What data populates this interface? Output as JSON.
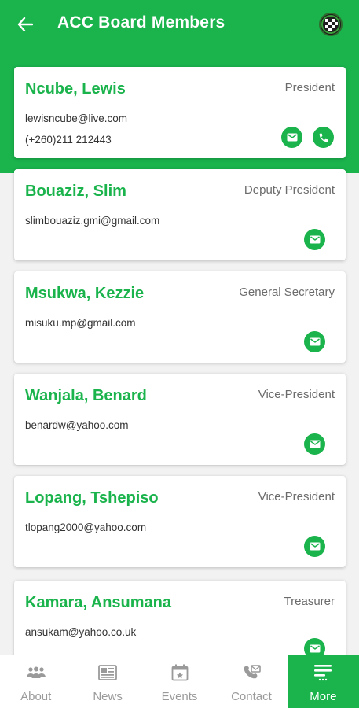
{
  "colors": {
    "brand": "#1ab34c",
    "nav_inactive": "#9a9a9a"
  },
  "header": {
    "title": "ACC Board Members",
    "back_icon": "arrow-left-icon",
    "logo_icon": "chess-club-logo"
  },
  "members": [
    {
      "name": "Ncube, Lewis",
      "role": "President",
      "email": "lewisncube@live.com",
      "phone": "(+260)211 212443"
    },
    {
      "name": "Bouaziz, Slim",
      "role": "Deputy President",
      "email": "slimbouaziz.gmi@gmail.com"
    },
    {
      "name": "Msukwa, Kezzie",
      "role": "General Secretary",
      "email": "misuku.mp@gmail.com"
    },
    {
      "name": "Wanjala, Benard",
      "role": "Vice-President",
      "email": "benardw@yahoo.com"
    },
    {
      "name": "Lopang, Tshepiso",
      "role": "Vice-President",
      "email": "tlopang2000@yahoo.com"
    },
    {
      "name": "Kamara, Ansumana",
      "role": "Treasurer",
      "email": "ansukam@yahoo.co.uk"
    }
  ],
  "nav": {
    "items": [
      {
        "label": "About",
        "icon": "people-icon"
      },
      {
        "label": "News",
        "icon": "newspaper-icon"
      },
      {
        "label": "Events",
        "icon": "calendar-icon"
      },
      {
        "label": "Contact",
        "icon": "contact-icon"
      },
      {
        "label": "More",
        "icon": "menu-icon"
      }
    ],
    "active": "More"
  }
}
